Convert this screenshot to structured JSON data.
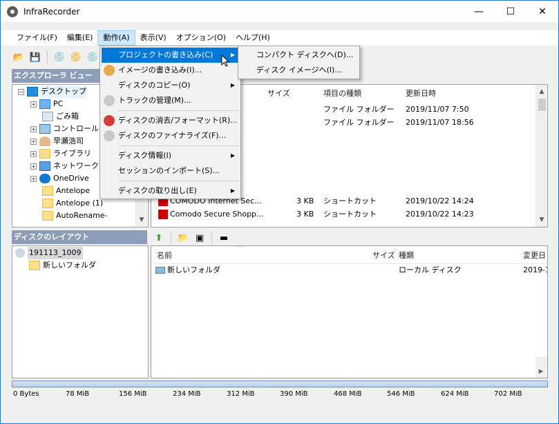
{
  "window": {
    "title": "InfraRecorder",
    "minimize": "—",
    "maximize": "☐",
    "close": "✕"
  },
  "menubar": [
    "ファイル(F)",
    "編集(E)",
    "動作(A)",
    "表示(V)",
    "オプション(O)",
    "ヘルプ(H)"
  ],
  "explorer": {
    "header": "エクスプローラ ビュー",
    "tree": [
      "デスクトップ",
      "PC",
      "ごみ箱",
      "コントロール /",
      "早瀬浩司",
      "ライブラリ",
      "ネットワーク",
      "OneDrive",
      "Antelope",
      "Antelope (1)",
      "AutoRename-"
    ],
    "columns": {
      "size": "サイズ",
      "type": "項目の種類",
      "date": "更新日時"
    },
    "rows": [
      {
        "name": "",
        "size": "",
        "type": "ファイル フォルダー",
        "date": "2019/11/07 7:50"
      },
      {
        "name": "",
        "size": "",
        "type": "ファイル フォルダー",
        "date": "2019/11/07 18:56"
      },
      {
        "name": "COMODO Internet Sec...",
        "size": "3 KB",
        "type": "ショートカット",
        "date": "2019/10/22 14:24"
      },
      {
        "name": "Comodo Secure Shopp...",
        "size": "3 KB",
        "type": "ショートカット",
        "date": "2019/10/22 14:23"
      }
    ]
  },
  "disc": {
    "header": "ディスクのレイアウト",
    "tree": [
      "191113_1009",
      "新しいフォルダ"
    ],
    "columns": {
      "name": "名前",
      "size": "サイズ",
      "type": "種類",
      "date": "変更日"
    },
    "rows": [
      {
        "name": "新しいフォルダ",
        "type": "ローカル ディスク",
        "date": "2019-1"
      }
    ]
  },
  "action_menu": {
    "items": [
      {
        "label": "プロジェクトの書き込み(C)",
        "submenu": true
      },
      {
        "label": "イメージの書き込み(I)...",
        "submenu": false
      },
      {
        "label": "ディスクのコピー(O)",
        "submenu": true
      },
      {
        "label": "トラックの管理(M)...",
        "submenu": false
      },
      {
        "label": "ディスクの消去/フォーマット(R)...",
        "submenu": false
      },
      {
        "label": "ディスクのファイナライズ(F)...",
        "submenu": false
      },
      {
        "label": "ディスク情報(I)",
        "submenu": true
      },
      {
        "label": "セッションのインポート(S)...",
        "submenu": false
      },
      {
        "label": "ディスクの取り出し(E)",
        "submenu": true
      }
    ]
  },
  "write_submenu": {
    "items": [
      "コンパクト ディスクへ(D)...",
      "ディスク イメージへ(I)..."
    ]
  },
  "capacity": {
    "progress": 0,
    "scale": [
      "0 Bytes",
      "78 MiB",
      "156 MiB",
      "234 MiB",
      "312 MiB",
      "390 MiB",
      "468 MiB",
      "546 MiB",
      "624 MiB",
      "702 MiB"
    ]
  },
  "colors": {
    "accent": "#0078d7",
    "pane_header": "#8c9eb7",
    "menu_hover": "#cce8ff"
  }
}
